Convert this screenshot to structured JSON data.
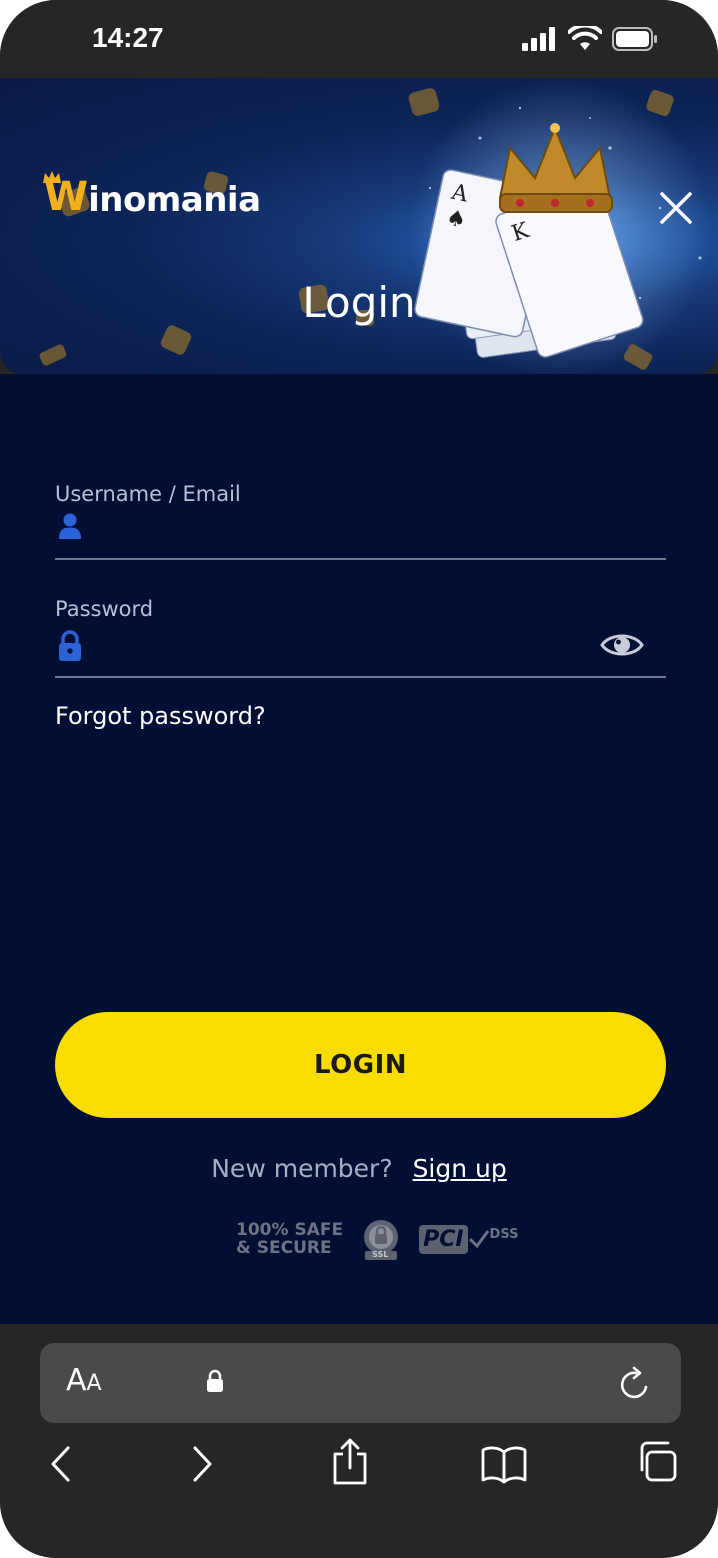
{
  "status_bar": {
    "time": "14:27"
  },
  "header": {
    "logo_w": "W",
    "logo_rest": "inomania",
    "title": "Login"
  },
  "form": {
    "username_label": "Username / Email",
    "password_label": "Password",
    "forgot_password": "Forgot password?",
    "login_button": "LOGIN",
    "new_member": "New member?",
    "sign_up": "Sign up"
  },
  "badges": {
    "safe_line1": "100% SAFE",
    "safe_line2": "& SECURE",
    "ssl": "SSL",
    "pci": "PCI",
    "dss": "DSS"
  },
  "browser": {
    "aa_large": "A",
    "aa_small": "A"
  },
  "colors": {
    "accent_yellow": "#f9dc01",
    "form_background": "#000f33",
    "logo_orange": "#f2b01e",
    "field_icon_blue": "#2c62d6"
  }
}
